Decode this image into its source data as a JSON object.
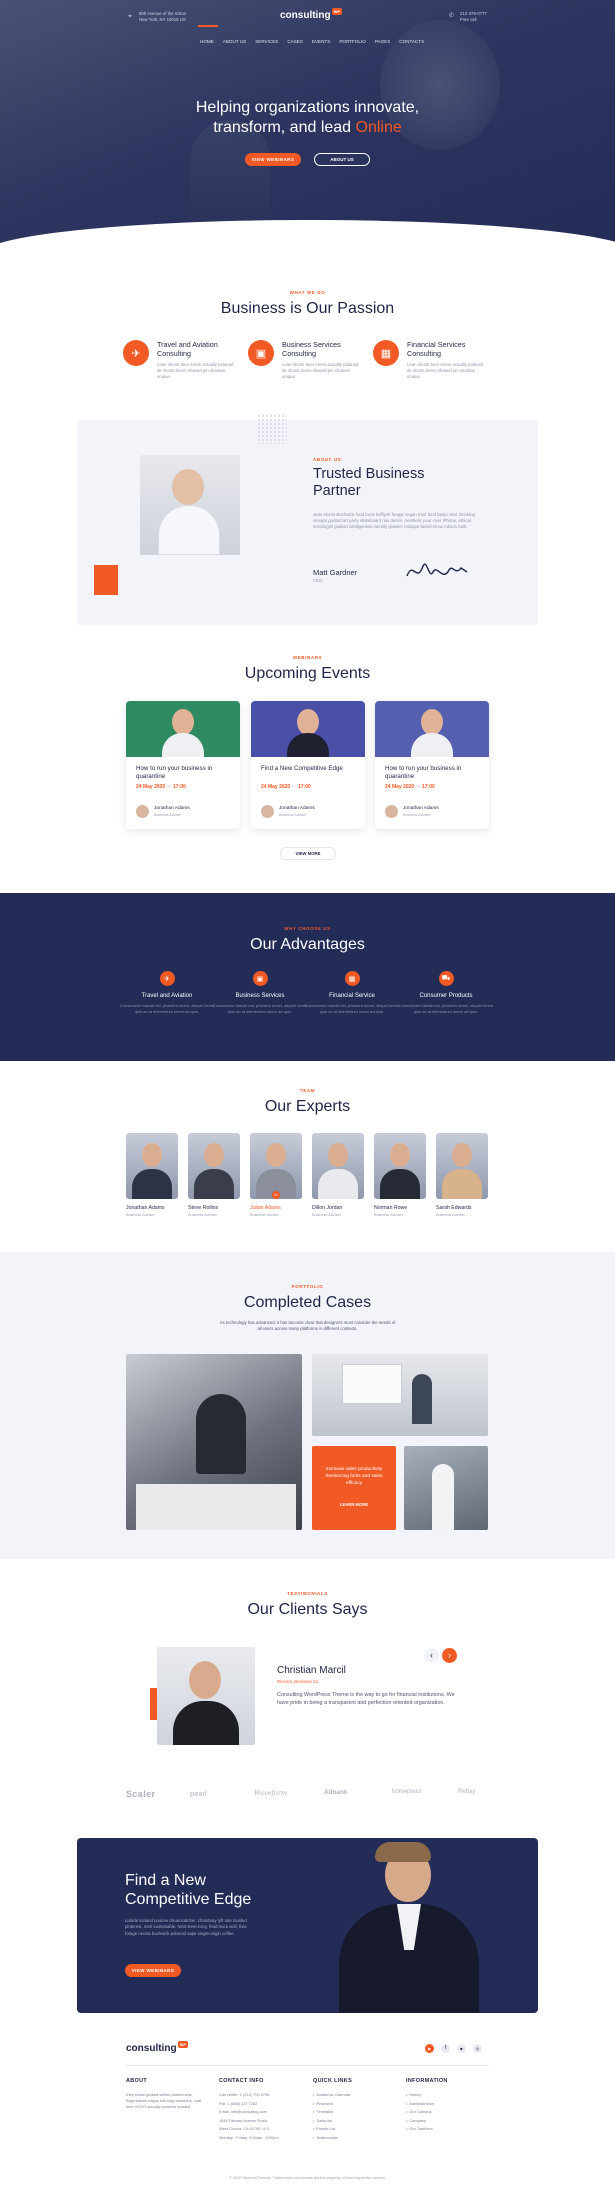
{
  "header": {
    "address_line1": "800 Avenue of the Sitron",
    "address_line2": "New York, NY 10018 US",
    "logo": "consulting",
    "logo_badge": "WP",
    "phone": "212-379-0777",
    "phone_label": "Free call"
  },
  "nav": [
    "HOME",
    "ABOUT US",
    "SERVICES",
    "CASES",
    "EVENTS",
    "PORTFOLIO",
    "PAGES",
    "CONTACTS"
  ],
  "hero": {
    "title_line1": "Helping organizations innovate,",
    "title_line2_pre": "transform, and lead ",
    "title_line2_accent": "Online",
    "btn_primary": "VIEW WEBINARS",
    "btn_secondary": "ABOUT US"
  },
  "passion": {
    "kicker": "WHAT WE DO",
    "title": "Business is Our Passion",
    "items": [
      {
        "title": "Travel and Aviation Consulting",
        "text": "Lean shorts beer lorem actually polaroid de shorts lorem shaved pin shaman unique.",
        "icon": "plane-icon"
      },
      {
        "title": "Business Services Consulting",
        "text": "Lean shorts beer lorem actually polaroid de shorts lorem shaved pin shaman unique.",
        "icon": "briefcase-icon"
      },
      {
        "title": "Financial Services Consulting",
        "text": "Lean shorts beer lorem actually polaroid de shorts lorem shaved pin shaman unique.",
        "icon": "calculator-icon"
      }
    ]
  },
  "about": {
    "kicker": "ABOUT US",
    "title_line1": "Trusted Business",
    "title_line2": "Partner",
    "text": "Jean shorts Bushwick food truck keffiyeh forage vegan trust fund banjo viral. Drinking vinegar godard art party skateboard raw denim. Aesthetic pour-over iPhone, ethical sociologist godard intelligentsia literally glossier mixtape beard ennui edison bulb.",
    "name": "Matt Gardner",
    "role": "CEO"
  },
  "events": {
    "kicker": "WEBINARS",
    "title": "Upcoming Events",
    "cards": [
      {
        "title": "How to run your business in quarantine",
        "date": "24 May 2020",
        "time": "17:00",
        "host": "Jonathan Adams",
        "host_role": "Business Adviser"
      },
      {
        "title": "Find a New Competitive Edge",
        "date": "24 May 2020",
        "time": "17:00",
        "host": "Jonathan Adams",
        "host_role": "Business Adviser"
      },
      {
        "title": "How to run your business in quarantine",
        "date": "24 May 2020",
        "time": "17:00",
        "host": "Jonathan Adams",
        "host_role": "Business Adviser"
      }
    ],
    "more": "VIEW MORE"
  },
  "advantages": {
    "kicker": "WHY CHOOSE US",
    "title": "Our Advantages",
    "items": [
      {
        "title": "Travel and Aviation",
        "text": "Consectetur blandit est, pharetra loreet, aliquet lorem quis ac at elementum lorem ad quis.",
        "icon": "plane-icon"
      },
      {
        "title": "Business Services",
        "text": "Consectetur blandit est, pharetra loreet, aliquet lorem quis ac at elementum lorem ad quis.",
        "icon": "briefcase-icon"
      },
      {
        "title": "Financial Service",
        "text": "Consectetur blandit est, pharetra loreet, aliquet lorem quis ac at elementum lorem ad quis.",
        "icon": "calculator-icon"
      },
      {
        "title": "Consumer Products",
        "text": "Consectetur blandit est, pharetra loreet, aliquet lorem quis ac at elementum lorem ad quis.",
        "icon": "cart-icon"
      }
    ]
  },
  "experts": {
    "kicker": "TEAM",
    "title": "Our Experts",
    "people": [
      {
        "name": "Jonathan Adams",
        "role": "Business Adviser"
      },
      {
        "name": "Steve Rollins",
        "role": "Business Adviser"
      },
      {
        "name": "Julian Adams",
        "role": "Business Adviser"
      },
      {
        "name": "Dillon Jordan",
        "role": "Business Adviser"
      },
      {
        "name": "Norman Rowe",
        "role": "Business Adviser"
      },
      {
        "name": "Sarah Edwards",
        "role": "Business Adviser"
      }
    ]
  },
  "cases": {
    "kicker": "PORTFOLIO",
    "title": "Completed Cases",
    "text_line1": "As technology has advanced, it has become clear that designers must consider the needs of",
    "text_line2": "all users across many platforms in different contexts.",
    "promo_text": "Increase sales productivity freelancing forks and sales efficacy",
    "promo_btn": "LEARN MORE"
  },
  "testimonials": {
    "kicker": "TESTIMONIALS",
    "title": "Our Clients Says",
    "name": "Christian Marcil",
    "role": "Director, Business Co.",
    "text": "Consulting WordPress Theme is the way to go for financial institutions. We have pride in being a transparent and perfection oriented organization.",
    "prev": "‹",
    "next": "›"
  },
  "partners": [
    "Scaler",
    "pearl",
    "Waveform",
    "Allbank",
    "homepress",
    "Rebay"
  ],
  "cta": {
    "title_line1": "Find a New",
    "title_line2": "Competitive Edge",
    "text": "Listicle iceland poutine dreamcatcher, chambray lyft tote tousled pinterest, meh sustainable. Next level irony, food truck wolf, fixie forage neutra bushwick polaroid vape single-origin coffee.",
    "btn": "VIEW WEBINARS"
  },
  "footer": {
    "logo": "consulting",
    "logo_badge": "WP",
    "about_title": "ABOUT",
    "about_text": "Etsy seitan godard selfies pickled kale, fingerstache migas tote bag mustache, craft beer XOXO actually pinterest tousled.",
    "contact_title": "CONTACT INFO",
    "contact": [
      "Call center: 1 (212) 700 0798",
      "Fax: 1 (888) 437 7282",
      "Email: info@consulting.com",
      "1845 Fairway Avenue Road",
      "West Covina, CA 91790, U.S.",
      "Monday - Friday: 9:00am - 5:00pm"
    ],
    "links_title": "QUICK LINKS",
    "links": [
      "Academic Calendar",
      "Research",
      "Timetable",
      "Sales list",
      "Events List",
      "Testimonials"
    ],
    "info_title": "INFORMATION",
    "info": [
      "History",
      "Administration",
      "Our Campus",
      "Company",
      "Our Teachers"
    ],
    "copyright": "© 2020 StylemixThemes. Trademarks and brands are the property of their respective owners."
  },
  "colors": {
    "accent": "#f15a24",
    "navy": "#1f2548",
    "navy_section": "#232b57",
    "light_bg": "#f3f4f9"
  }
}
